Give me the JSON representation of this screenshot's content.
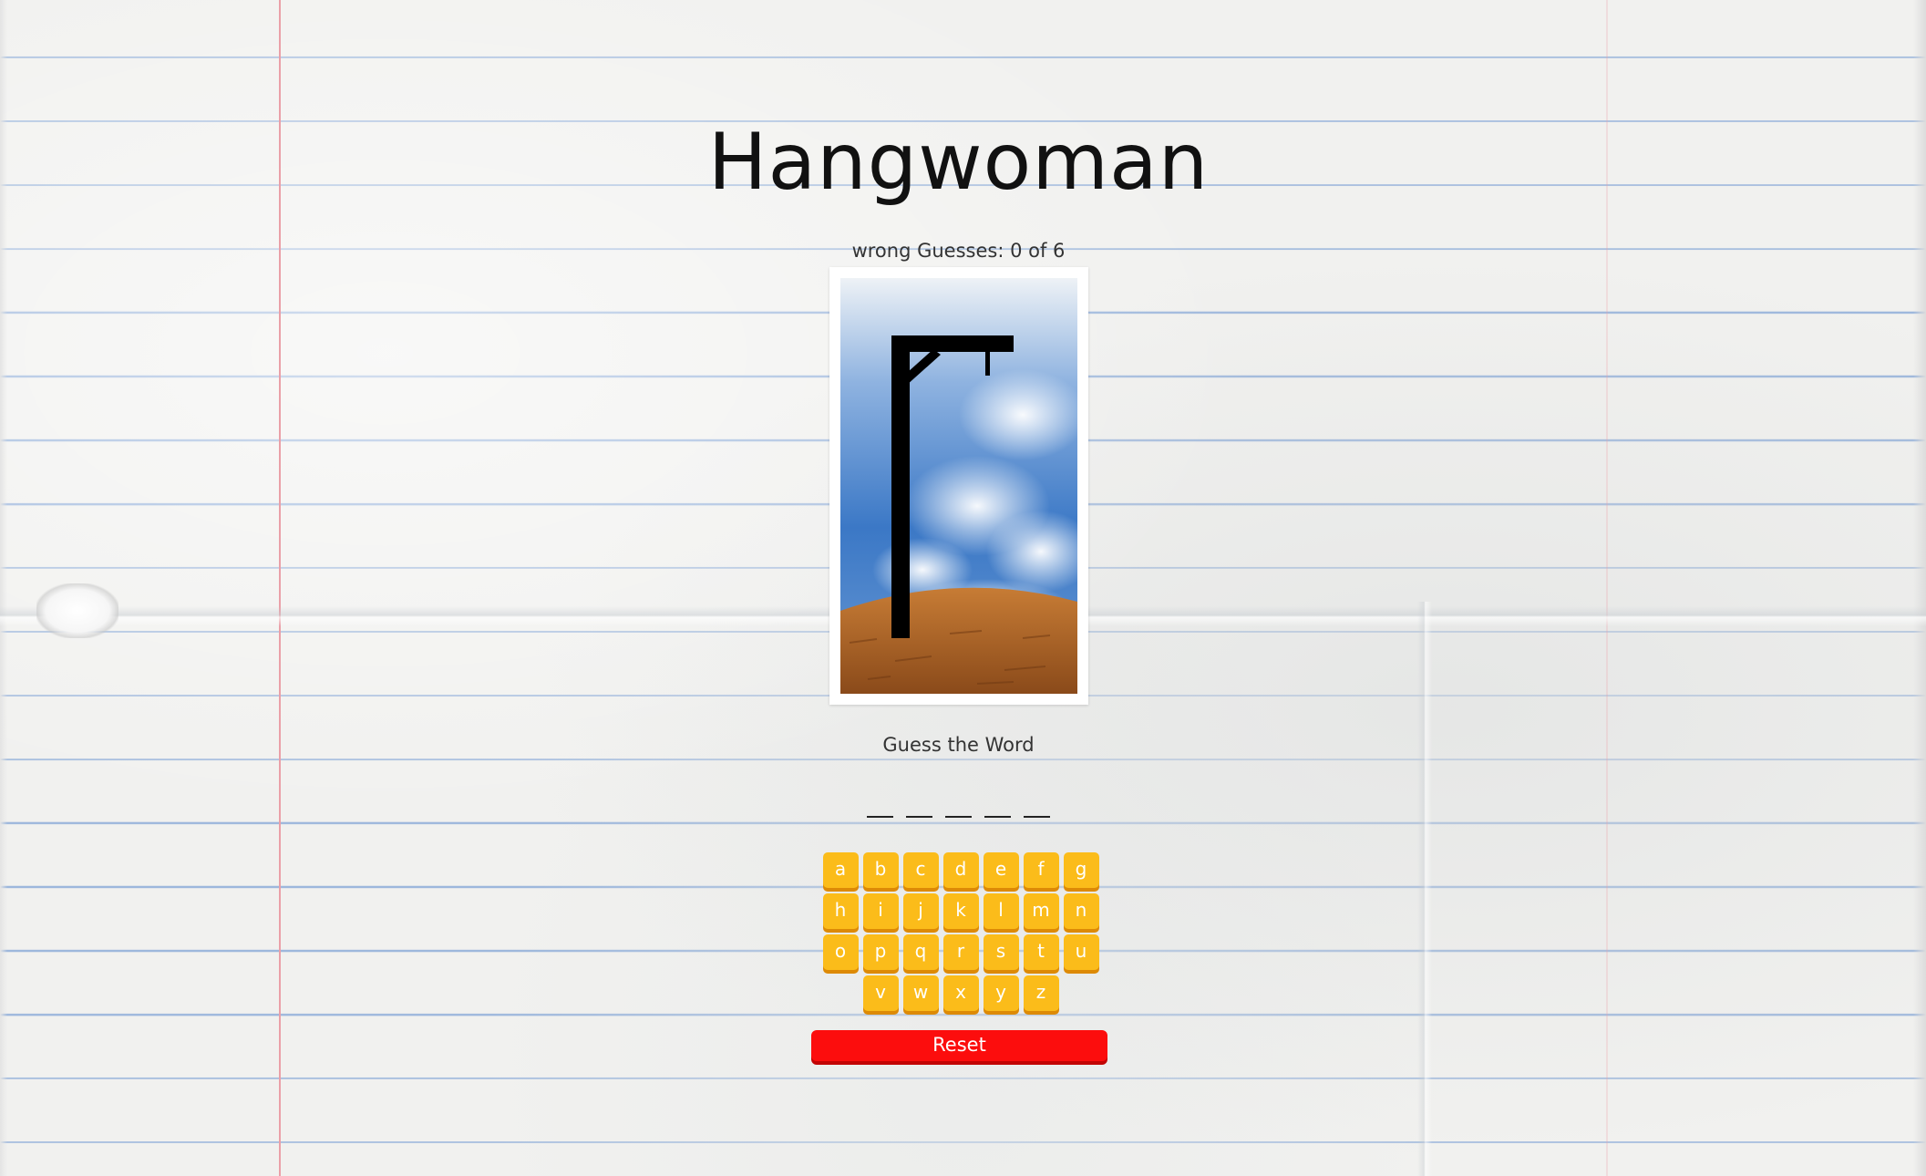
{
  "game": {
    "title": "Hangwoman",
    "wrong_guesses_label": "wrong Guesses: 0 of 6",
    "wrong_guesses_count": 0,
    "max_wrong_guesses": 6,
    "guess_prompt": "Guess the Word",
    "word_blanks": [
      "",
      "",
      "",
      "",
      ""
    ],
    "keyboard_rows": [
      [
        "a",
        "b",
        "c",
        "d",
        "e",
        "f",
        "g"
      ],
      [
        "h",
        "i",
        "j",
        "k",
        "l",
        "m",
        "n"
      ],
      [
        "o",
        "p",
        "q",
        "r",
        "s",
        "t",
        "u"
      ],
      [
        "v",
        "w",
        "x",
        "y",
        "z"
      ]
    ],
    "reset_label": "Reset"
  },
  "colors": {
    "key_bg": "#fbbc1a",
    "key_shadow": "#dd8a06",
    "reset_bg": "#fc0d0d",
    "paper_line": "#9db7dc",
    "margin_line": "#eaa0a8"
  }
}
